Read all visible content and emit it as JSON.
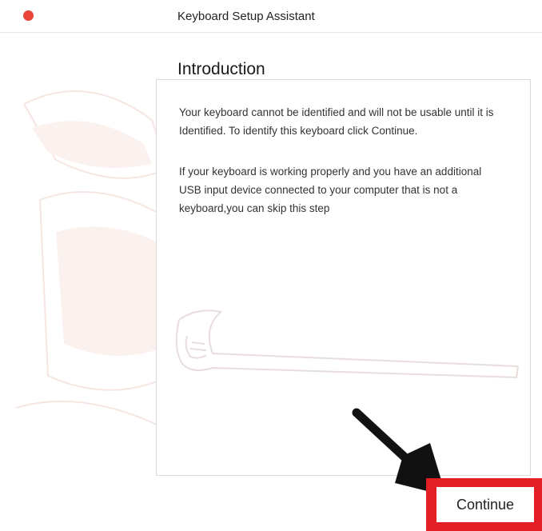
{
  "window": {
    "title": "Keyboard Setup Assistant",
    "close_button_color": "#e8443a"
  },
  "page": {
    "heading": "Introduction",
    "paragraphs": [
      "Your keyboard cannot be identified and will not be usable until it is Identified. To identify this keyboard click Continue.",
      "If your keyboard is working properly and you have an additional USB input device connected to your computer that is not a keyboard,you can skip this step"
    ]
  },
  "actions": {
    "continue_label": "Continue"
  },
  "annotations": {
    "highlight_color": "#e31e24",
    "arrow_color": "#111111"
  },
  "icons": [
    "close-icon",
    "arrow-pointer-icon",
    "keyboard-illustration"
  ]
}
